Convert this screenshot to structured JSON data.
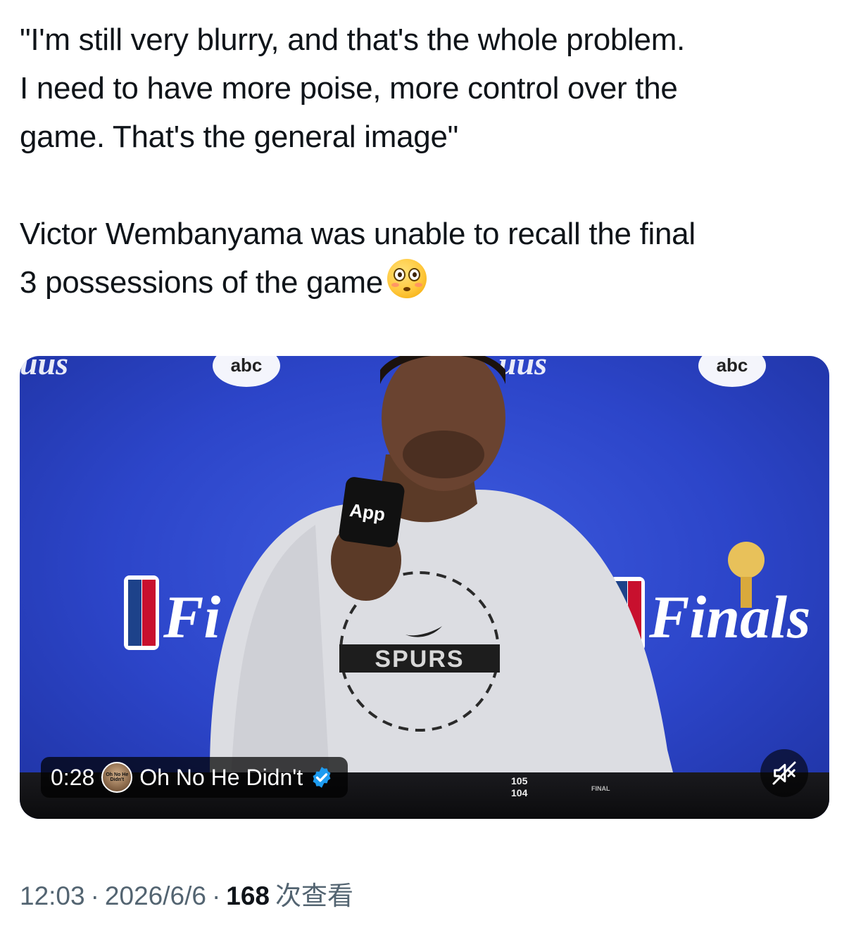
{
  "tweet": {
    "text_lines": [
      "\"I'm still very blurry, and that's the whole problem.",
      "I need to have more poise, more control over the",
      "game. That's the general image\"",
      "Victor Wembanyama was unable to recall the final",
      "3 possessions of the game"
    ],
    "emoji": "flushed-face-emoji"
  },
  "video": {
    "elapsed": "0:28",
    "source_name": "Oh No He Didn't",
    "source_avatar_text": "Oh No He Didn't",
    "verified": true,
    "mic_flag_text": "App",
    "shirt_text": "SPURS",
    "backdrop_text": "Finals",
    "backdrop_logo_text": "abc",
    "score_top": "105",
    "score_bottom": "104",
    "score_status": "FINAL",
    "mute_icon": "speaker-muted-icon",
    "colors": {
      "backdrop": "#2c45c9",
      "verified": "#1d9bf0"
    }
  },
  "meta": {
    "time": "12:03",
    "date": "2026/6/6",
    "views_count": "168",
    "views_label": "次查看",
    "separator": "·"
  }
}
